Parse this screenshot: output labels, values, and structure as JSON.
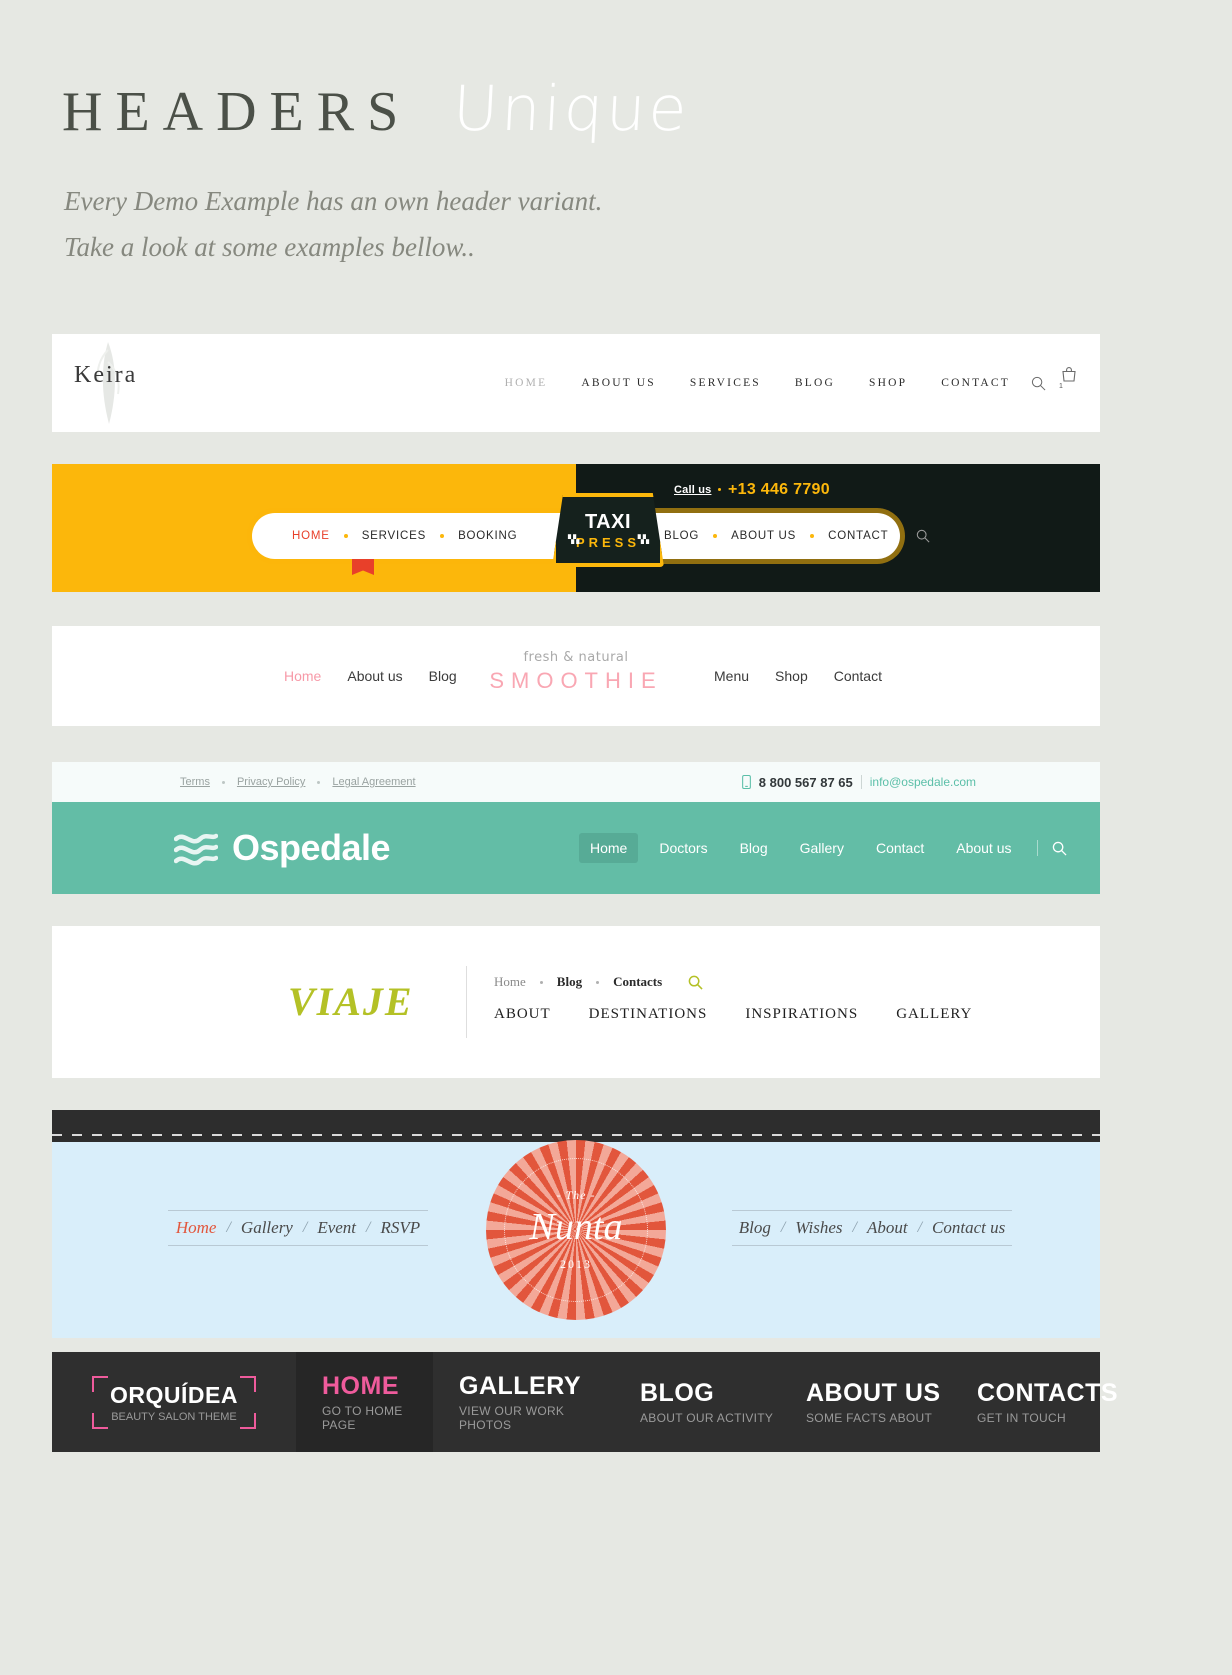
{
  "intro": {
    "title_main": "HEADERS",
    "title_script": "Unique",
    "subtitle_line1": "Every Demo Example has an own header variant.",
    "subtitle_line2": "Take a look at some examples bellow..",
    "bg_color": "#e6e8e3"
  },
  "keira": {
    "logo": "Keira",
    "nav": [
      {
        "label": "HOME",
        "active": true
      },
      {
        "label": "ABOUT US",
        "active": false
      },
      {
        "label": "SERVICES",
        "active": false
      },
      {
        "label": "BLOG",
        "active": false
      },
      {
        "label": "SHOP",
        "active": false
      },
      {
        "label": "CONTACT",
        "active": false
      }
    ],
    "cart_count": "1"
  },
  "taxi": {
    "call_label": "Call us",
    "phone": "+13 446 7790",
    "sign_top": "TAXI",
    "sign_bottom": "PRESS",
    "nav_left": [
      {
        "label": "HOME",
        "active": true
      },
      {
        "label": "SERVICES",
        "active": false
      },
      {
        "label": "BOOKING",
        "active": false
      }
    ],
    "nav_right": [
      {
        "label": "BLOG",
        "active": false
      },
      {
        "label": "ABOUT US",
        "active": false
      },
      {
        "label": "CONTACT",
        "active": false
      }
    ],
    "colors": {
      "yellow": "#fcb70b",
      "dark": "#111a17",
      "red": "#e8402a"
    }
  },
  "smoothie": {
    "nav_left": [
      {
        "label": "Home",
        "active": true
      },
      {
        "label": "About us",
        "active": false
      },
      {
        "label": "Blog",
        "active": false
      }
    ],
    "nav_right": [
      {
        "label": "Menu",
        "active": false
      },
      {
        "label": "Shop",
        "active": false
      },
      {
        "label": "Contact",
        "active": false
      }
    ],
    "tagline": "fresh & natural",
    "wordmark": "SMOOTHIE",
    "accent": "#f79aa8"
  },
  "ospedale": {
    "top_links": [
      "Terms",
      "Privacy Policy",
      "Legal Agreement"
    ],
    "phone": "8 800 567 87 65",
    "email": "info@ospedale.com",
    "logo": "Ospedale",
    "nav": [
      {
        "label": "Home",
        "active": true
      },
      {
        "label": "Doctors",
        "active": false
      },
      {
        "label": "Blog",
        "active": false
      },
      {
        "label": "Gallery",
        "active": false
      },
      {
        "label": "Contact",
        "active": false
      },
      {
        "label": "About us",
        "active": false
      }
    ],
    "accent": "#63bda6"
  },
  "viaje": {
    "logo": "VIAJE",
    "top_nav": [
      {
        "label": "Home",
        "muted": true
      },
      {
        "label": "Blog",
        "muted": false
      },
      {
        "label": "Contacts",
        "muted": false
      }
    ],
    "main_nav": [
      "ABOUT",
      "DESTINATIONS",
      "INSPIRATIONS",
      "GALLERY"
    ],
    "accent": "#b4c126"
  },
  "nunta": {
    "nav_left": [
      {
        "label": "Home",
        "active": true
      },
      {
        "label": "Gallery",
        "active": false
      },
      {
        "label": "Event",
        "active": false
      },
      {
        "label": "RSVP",
        "active": false
      }
    ],
    "nav_right": [
      {
        "label": "Blog",
        "active": false
      },
      {
        "label": "Wishes",
        "active": false
      },
      {
        "label": "About",
        "active": false
      },
      {
        "label": "Contact us",
        "active": false
      }
    ],
    "badge_the": "- The -",
    "badge_name": "Nunta",
    "badge_year": "2013",
    "accent": "#e2563c",
    "bg": "#d9eefa"
  },
  "orquidea": {
    "brand_name": "ORQUÍDEA",
    "brand_sub": "BEAUTY SALON THEME",
    "items": [
      {
        "title": "HOME",
        "sub": "GO TO HOME PAGE",
        "active": true
      },
      {
        "title": "GALLERY",
        "sub": "VIEW OUR WORK PHOTOS",
        "active": false
      },
      {
        "title": "BLOG",
        "sub": "ABOUT OUR ACTIVITY",
        "active": false
      },
      {
        "title": "ABOUT US",
        "sub": "SOME FACTS ABOUT",
        "active": false
      },
      {
        "title": "CONTACTS",
        "sub": "GET IN TOUCH",
        "active": false
      }
    ],
    "accent": "#ef5b9c"
  }
}
